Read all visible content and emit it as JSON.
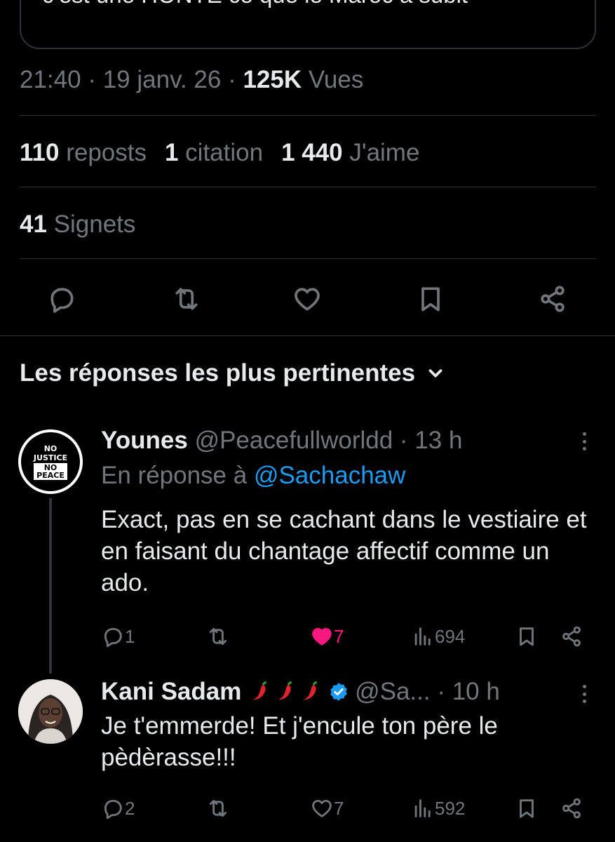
{
  "quoted": {
    "text": "c’est une HONTE ce que le Maroc a subit"
  },
  "meta": {
    "time": "21:40",
    "sep1": " · ",
    "date": "19 janv. 26",
    "sep2": " · ",
    "views_count": "125K",
    "views_label": " Vues"
  },
  "stats": {
    "reposts_count": "110",
    "reposts_label": " reposts",
    "quotes_count": "1",
    "quotes_label": " citation",
    "likes_count": "1 440",
    "likes_label": " J'aime",
    "bookmarks_count": "41",
    "bookmarks_label": " Signets"
  },
  "actions": [
    "reply-icon",
    "repost-icon",
    "like-icon",
    "bookmark-icon",
    "share-icon"
  ],
  "sort": {
    "label": "Les réponses les plus pertinentes"
  },
  "replies": [
    {
      "name": "Younes",
      "handle": "@Peacefullworldd",
      "time": " · 13 h",
      "avatar_text": [
        "NO",
        "JUSTICE",
        "NO",
        "PEACE"
      ],
      "reply_prefix": "En réponse à ",
      "reply_handle": "@Sachachaw",
      "body": "Exact, pas en se cachant dans le vestiaire et en faisant du chantage affectif comme un ado.",
      "reply_count": "1",
      "like_count": "7",
      "view_count": "694",
      "liked": true
    },
    {
      "name": "Kani Sadam",
      "handle": "@Sa...",
      "time": " · 10 h",
      "badges": [
        "chili-pepper-icon",
        "chili-pepper-icon",
        "chili-pepper-icon",
        "verified-badge-icon"
      ],
      "body": "Je t'emmerde! Et j'encule ton père le pèdèrasse!!!",
      "reply_count": "2",
      "like_count": "7",
      "view_count": "592",
      "liked": false
    }
  ],
  "colors": {
    "background": "#000000",
    "text": "#e7e9ea",
    "muted": "#71767b",
    "link": "#1d9bf0",
    "like": "#f91880",
    "divider": "#2f3336"
  }
}
